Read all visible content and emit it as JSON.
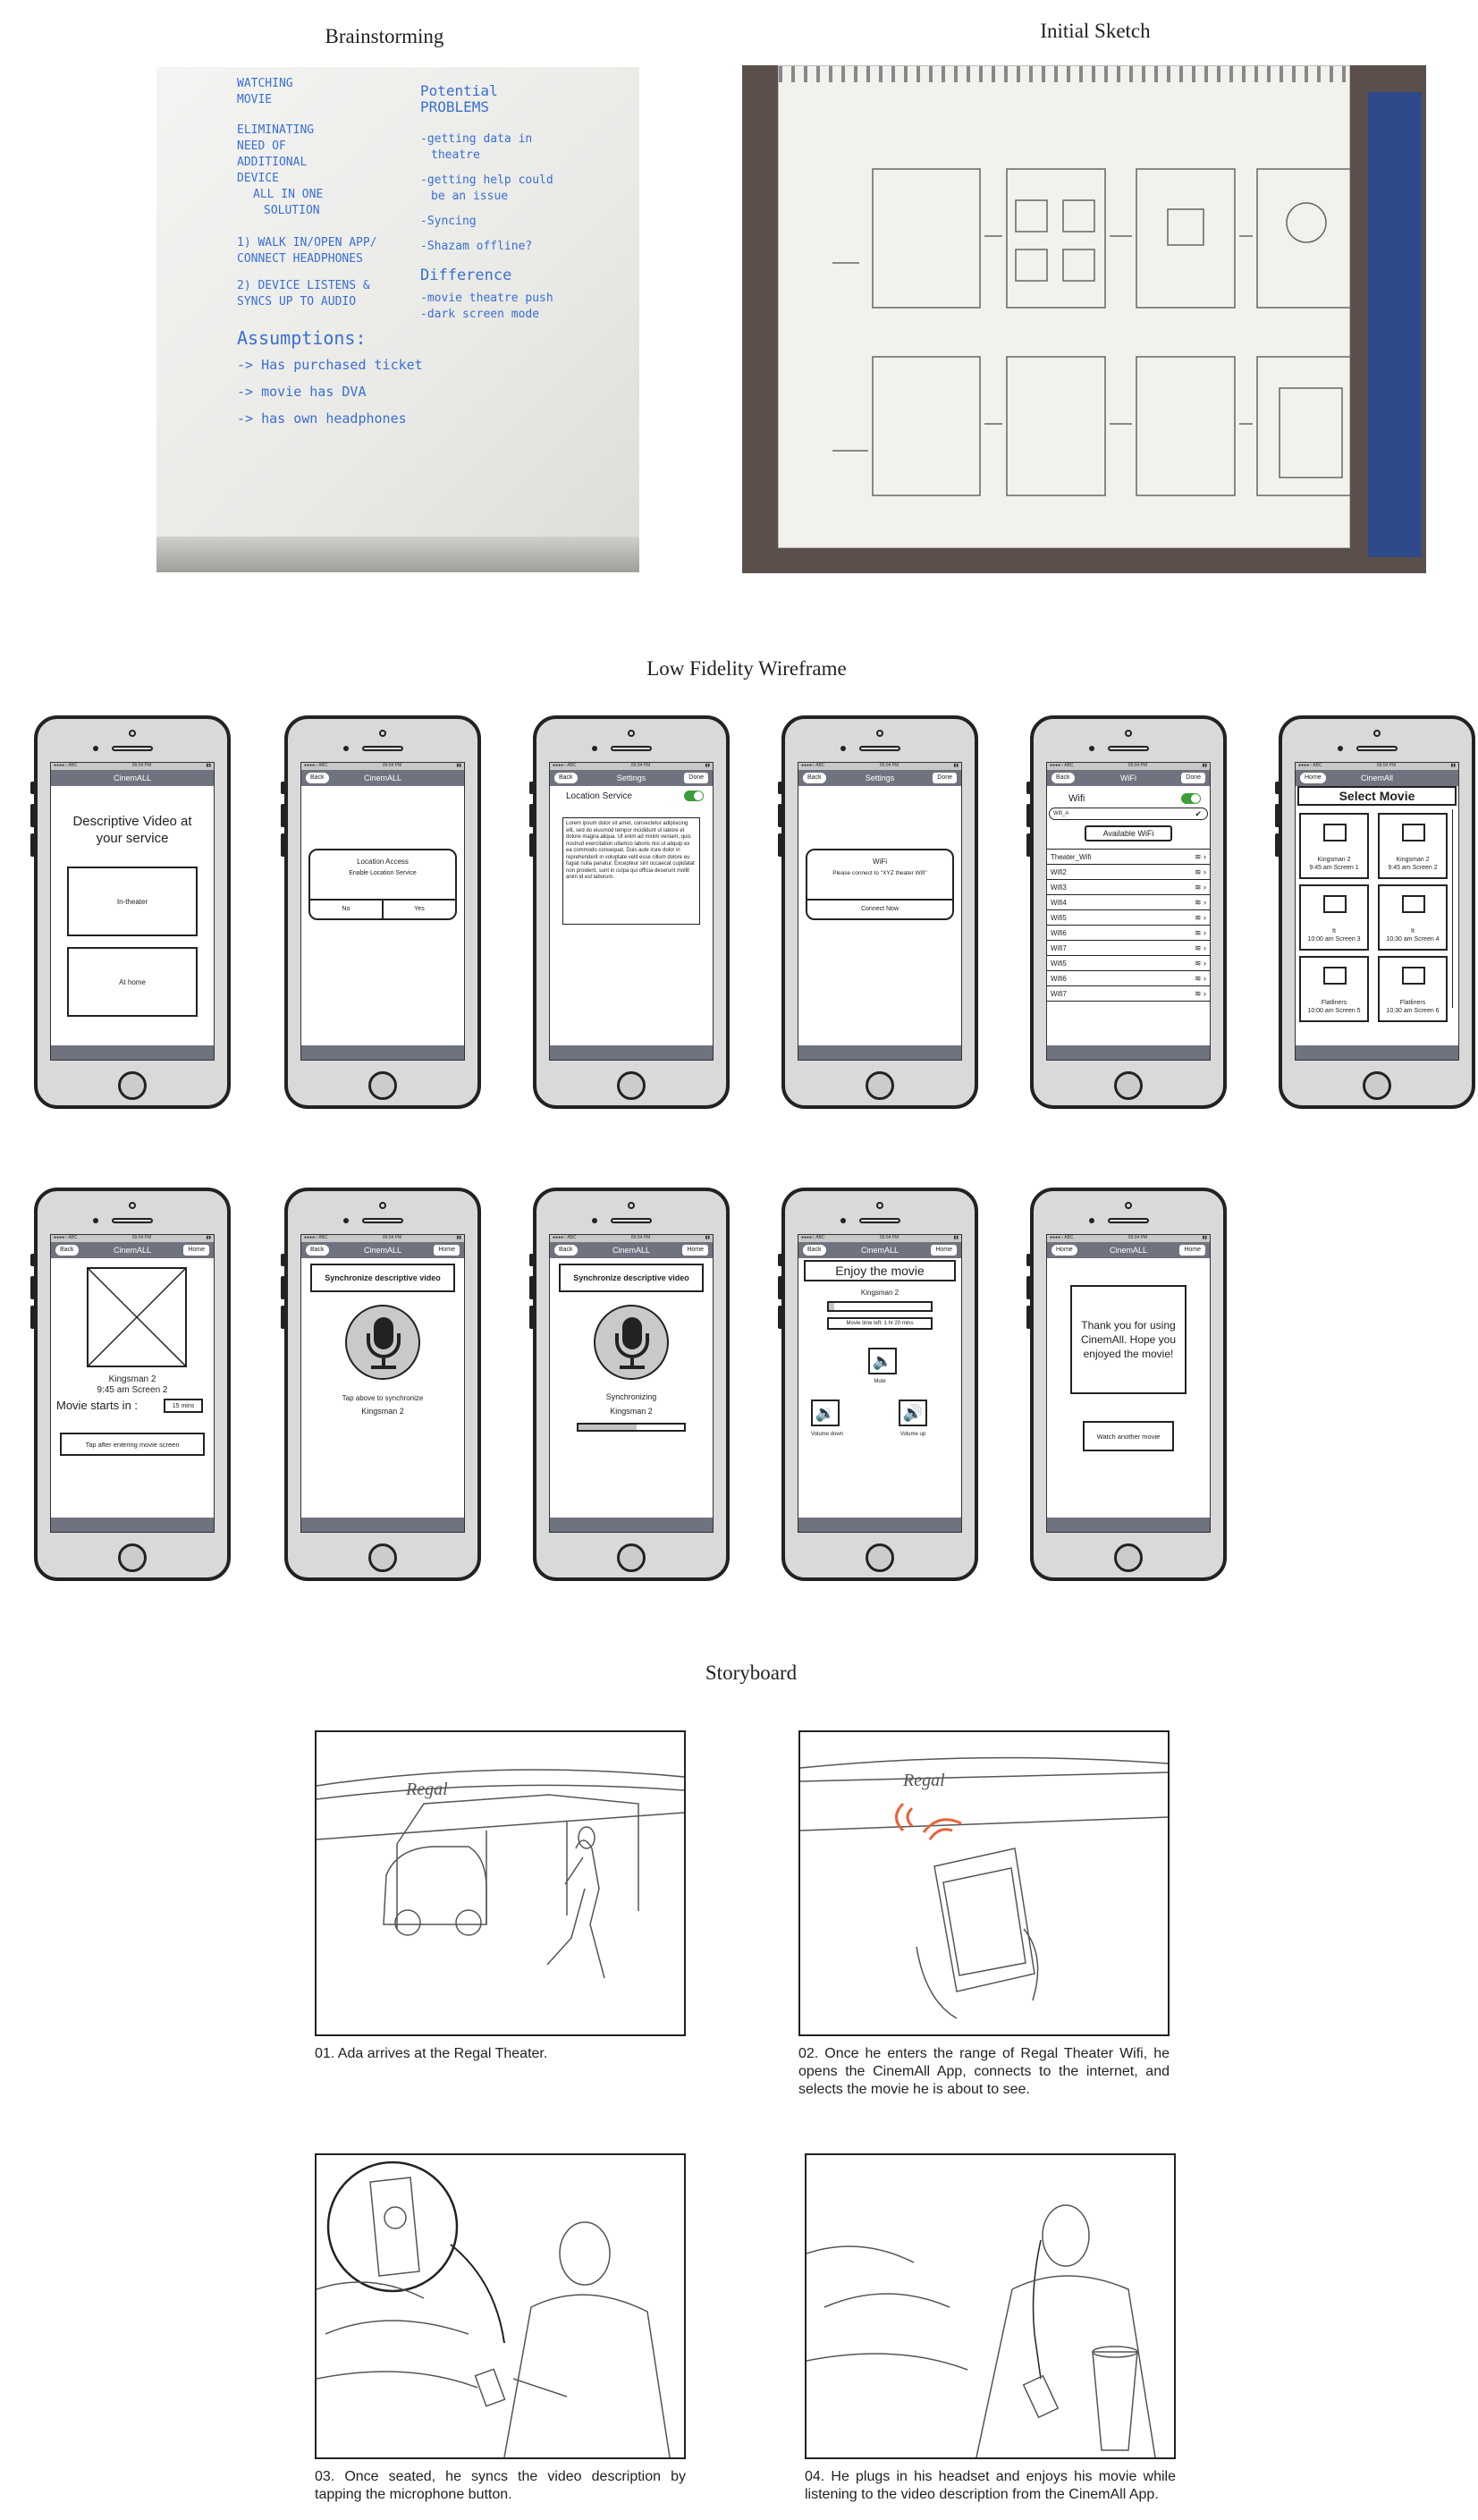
{
  "sections": {
    "brainstorming": "Brainstorming",
    "initial_sketch": "Initial Sketch",
    "wireframe": "Low Fidelity Wireframe",
    "storyboard": "Storyboard"
  },
  "whiteboard": {
    "col1": [
      "WATCHING",
      "MOVIE",
      "ELIMINATING",
      "NEED OF",
      "ADDITIONAL",
      "DEVICE",
      "ALL IN ONE",
      "SOLUTION",
      "1) WALK IN/OPEN APP/",
      "CONNECT HEADPHONES",
      "2) DEVICE LISTENS &",
      "SYNCS UP TO AUDIO",
      "Assumptions:",
      "-> Has purchased ticket",
      "-> movie has DVA",
      "-> has own headphones"
    ],
    "col2": [
      "Potential",
      "PROBLEMS",
      "-getting data in",
      "theatre",
      "-getting help could",
      "be an issue",
      "-Syncing",
      "-Shazam offline?",
      "Difference",
      "-movie theatre push",
      "-dark screen mode"
    ]
  },
  "status_bar": {
    "carrier": "●●●●○ ABC",
    "time": "09:04 PM",
    "battery": "▮▮"
  },
  "phones": {
    "p1": {
      "nav": "CinemALL",
      "heading": "Descriptive Video at your service",
      "opt1": "In-theater",
      "opt2": "At home"
    },
    "p2": {
      "back": "Back",
      "nav": "CinemALL",
      "title": "Location Access",
      "msg": "Enable Location Service",
      "no": "No",
      "yes": "Yes"
    },
    "p3": {
      "back": "Back",
      "nav": "Settings",
      "done": "Done",
      "label": "Location Service",
      "lorem": "Lorem ipsum dolor sit amet, consectetur adipisicing elit, sed do eiusmod tempor incididunt ut labore et dolore magna aliqua. Ut enim ad minim veniam, quis nostrud exercitation ullamco laboris nisi ut aliquip ex ea commodo consequat. Duis aute irure dolor in reprehenderit in voluptate velit esse cillum dolore eu fugiat nulla pariatur. Excepteur sint occaecat cupidatat non proident, sunt in culpa qui officia deserunt mollit anim id est laborum."
    },
    "p4": {
      "back": "Back",
      "nav": "Settings",
      "done": "Done",
      "title": "WiFi",
      "msg": "Please connect to \"XYZ theater Wifi\"",
      "btn": "Connect Now"
    },
    "p5": {
      "back": "Back",
      "nav": "WiFi",
      "done": "Done",
      "label": "Wifi",
      "current": "Wifi_A",
      "available": "Available WiFi",
      "networks": [
        "Theater_Wifi",
        "Wifi2",
        "Wifi3",
        "Wifi4",
        "Wifi5",
        "Wifi6",
        "Wifi7",
        "Wifi5",
        "Wifi6",
        "Wifi7"
      ]
    },
    "p6": {
      "home": "Home",
      "nav": "CinemAll",
      "heading": "Select Movie",
      "movies": [
        {
          "name": "Kingsman 2",
          "time": "9:45 am Screen 1"
        },
        {
          "name": "Kingsman 2",
          "time": "9:45 am Screen 2"
        },
        {
          "name": "It",
          "time": "10:00 am Screen 3"
        },
        {
          "name": "It",
          "time": "10:30 am Screen 4"
        },
        {
          "name": "Flatliners",
          "time": "10:00 am Screen 5"
        },
        {
          "name": "Flatliners",
          "time": "10:30 am Screen 6"
        }
      ]
    },
    "p7": {
      "back": "Back",
      "nav": "CinemALL",
      "home": "Home",
      "movie": "Kingsman 2",
      "time": "9:45 am Screen 2",
      "starts": "Movie starts in :",
      "mins": "15 mins",
      "btn": "Tap after entering movie screen"
    },
    "p8": {
      "back": "Back",
      "nav": "CinemALL",
      "home": "Home",
      "heading": "Synchronize descriptive video",
      "hint": "Tap above to synchronize",
      "movie": "Kingsman 2"
    },
    "p9": {
      "back": "Back",
      "nav": "CinemALL",
      "home": "Home",
      "heading": "Synchronize descriptive video",
      "status": "Synchronizing",
      "movie": "Kingsman 2",
      "progress": 0.55
    },
    "p10": {
      "back": "Back",
      "nav": "CinemALL",
      "home": "Home",
      "heading": "Enjoy the movie",
      "movie": "Kingsman 2",
      "time_left": "Movie time left: 1 hr 20 mins",
      "progress": 0.05,
      "mute": "Mute",
      "vol_down": "Volume down",
      "vol_up": "Volume up"
    },
    "p11": {
      "home": "Home",
      "nav": "CinemALL",
      "home2": "Home",
      "message": "Thank you for using CinemAll. Hope you enjoyed the movie!",
      "btn": "Watch another movie"
    }
  },
  "storyboard": {
    "c1": "01. Ada arrives at the Regal Theater.",
    "c2": "02. Once he enters the range of Regal Theater Wifi, he opens the CinemAll App, connects to the internet, and selects the movie he is about to see.",
    "c3": "03. Once seated, he syncs the video description by tapping the microphone button.",
    "c4": "04. He plugs in his headset and enjoys his movie while listening to the video description from the CinemAll App.",
    "sign": "Regal"
  },
  "colors": {
    "navbar": "#6f737f",
    "toggle": "#3a9e3a",
    "whiteboard_ink": "#3a6fd0",
    "signal": "#e8633a"
  }
}
